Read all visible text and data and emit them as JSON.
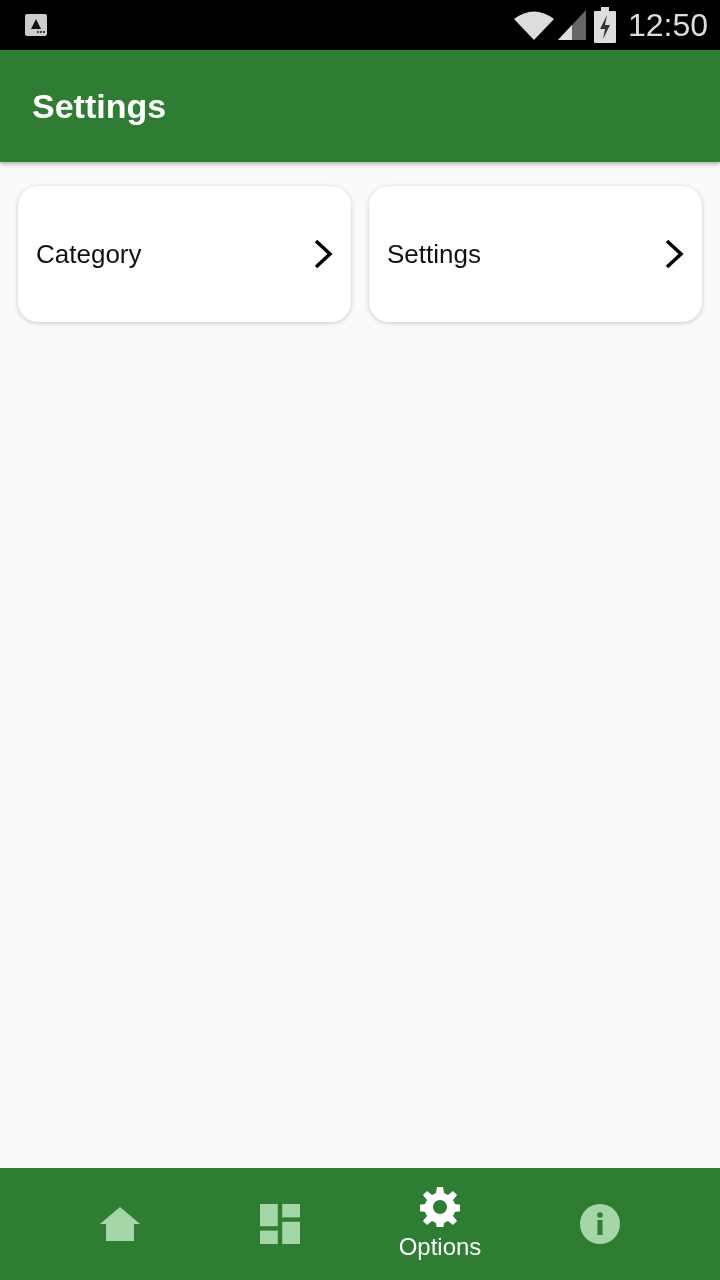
{
  "status_bar": {
    "time": "12:50"
  },
  "app_bar": {
    "title": "Settings"
  },
  "cards": [
    {
      "label": "Category"
    },
    {
      "label": "Settings"
    }
  ],
  "bottom_nav": [
    {
      "kind": "home",
      "selected": false
    },
    {
      "kind": "dashboard",
      "selected": false
    },
    {
      "kind": "options",
      "label": "Options",
      "selected": true
    },
    {
      "kind": "info",
      "selected": false
    }
  ]
}
